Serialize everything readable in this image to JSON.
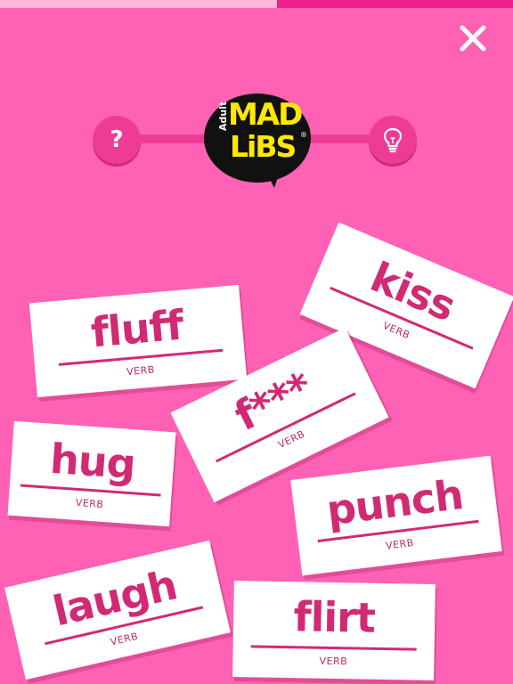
{
  "progress": 0.46,
  "colors": {
    "background": "#ff62b4",
    "accent": "#ee3c95",
    "card_text": "#d12a74",
    "logo_text": "#ffe800"
  },
  "header": {
    "close_icon": "close-icon",
    "help_label": "?",
    "hint_icon": "lightbulb-icon"
  },
  "logo": {
    "adult": "Adult",
    "mad": "MAD",
    "libs": "LiBS",
    "trademark": "®"
  },
  "cards": [
    {
      "word": "fluff",
      "label": "VERB"
    },
    {
      "word": "kiss",
      "label": "VERB"
    },
    {
      "word": "f***",
      "label": "VERB"
    },
    {
      "word": "hug",
      "label": "VERB"
    },
    {
      "word": "punch",
      "label": "VERB"
    },
    {
      "word": "laugh",
      "label": "VERB"
    },
    {
      "word": "flirt",
      "label": "VERB"
    }
  ]
}
